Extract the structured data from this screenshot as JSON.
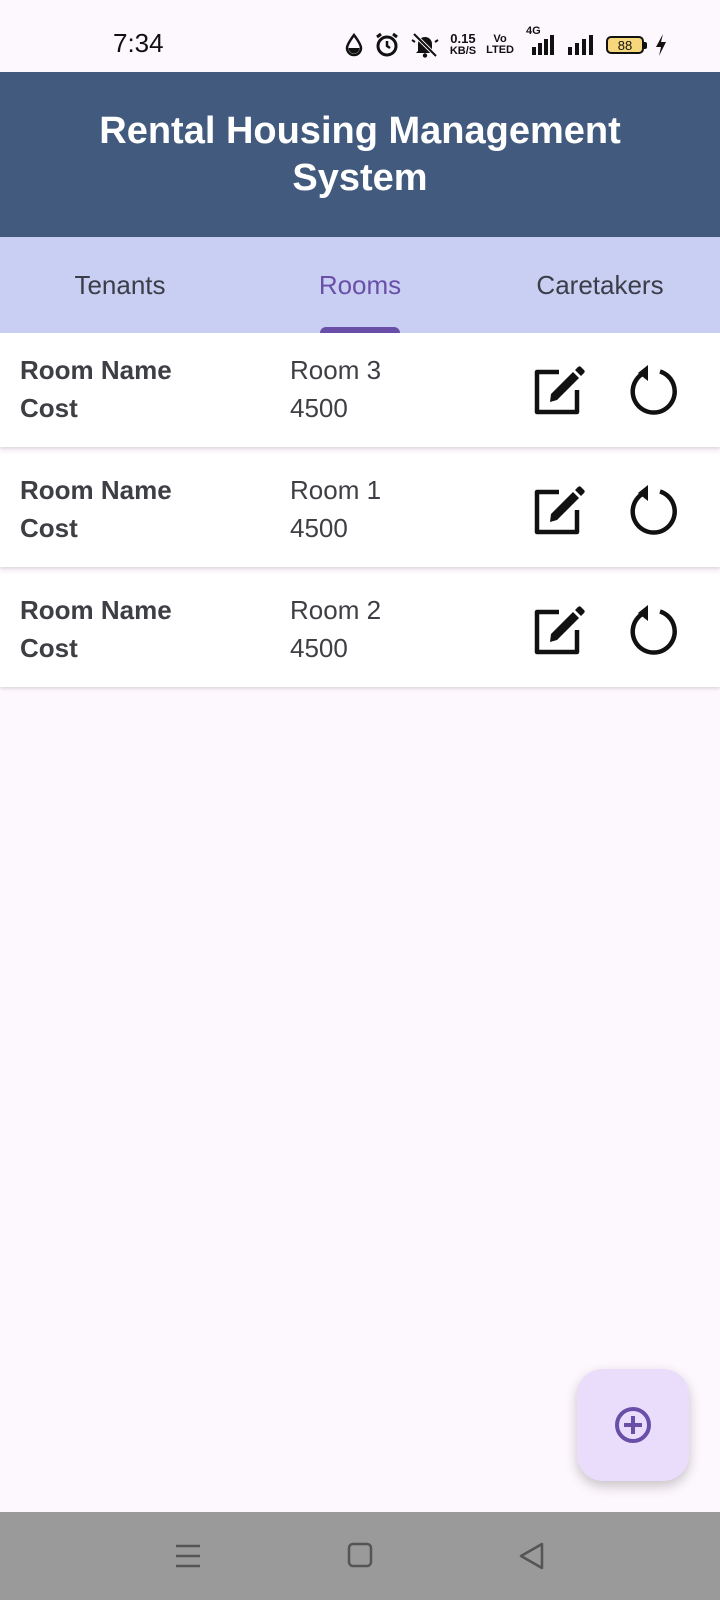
{
  "status_bar": {
    "time": "7:34",
    "net_speed_value": "0.15",
    "net_speed_unit": "KB/S",
    "volte_top": "Vo",
    "volte_bottom": "LTED",
    "network_type": "4G",
    "battery_level": "88"
  },
  "app_bar": {
    "title": "Rental Housing Management System"
  },
  "tabs": [
    {
      "label": "Tenants",
      "active": false
    },
    {
      "label": "Rooms",
      "active": true
    },
    {
      "label": "Caretakers",
      "active": false
    }
  ],
  "rooms": [
    {
      "name_label": "Room Name",
      "cost_label": "Cost",
      "name": "Room 3",
      "cost": "4500"
    },
    {
      "name_label": "Room Name",
      "cost_label": "Cost",
      "name": "Room 1",
      "cost": "4500"
    },
    {
      "name_label": "Room Name",
      "cost_label": "Cost",
      "name": "Room 2",
      "cost": "4500"
    }
  ],
  "icons": {
    "edit": "edit-icon",
    "reset": "rotate-ccw-icon",
    "fab": "add-circle-icon"
  },
  "colors": {
    "app_bar": "#415a7d",
    "tab_bar": "#c8cff3",
    "accent": "#6a4fa8",
    "fab": "#eaddfc",
    "background": "#fdf8fd"
  }
}
